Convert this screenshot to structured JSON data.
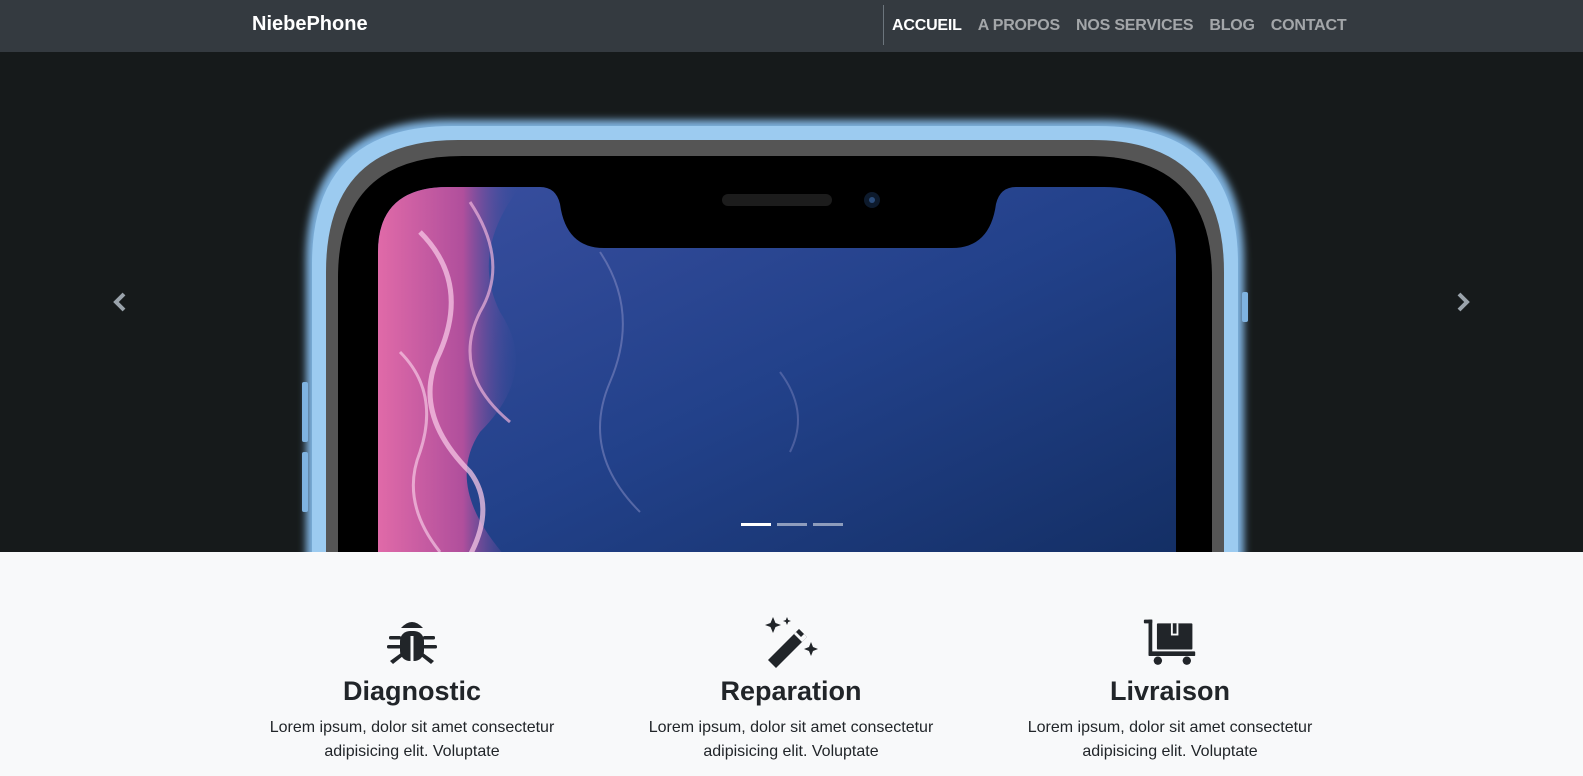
{
  "navbar": {
    "brand": "NiebePhone",
    "items": [
      {
        "label": "ACCUEIL",
        "active": true
      },
      {
        "label": "A PROPOS",
        "active": false
      },
      {
        "label": "NOS SERVICES",
        "active": false
      },
      {
        "label": "BLOG",
        "active": false
      },
      {
        "label": "CONTACT",
        "active": false
      }
    ]
  },
  "carousel": {
    "prev_icon": "chevron-left-icon",
    "next_icon": "chevron-right-icon",
    "slide_count": 3,
    "active_index": 0
  },
  "features": [
    {
      "icon": "bug-icon",
      "title": "Diagnostic",
      "text": "Lorem ipsum, dolor sit amet consectetur adipisicing elit. Voluptate"
    },
    {
      "icon": "magic-wand-icon",
      "title": "Reparation",
      "text": "Lorem ipsum, dolor sit amet consectetur adipisicing elit. Voluptate"
    },
    {
      "icon": "dolly-icon",
      "title": "Livraison",
      "text": "Lorem ipsum, dolor sit amet consectetur adipisicing elit. Voluptate"
    }
  ],
  "colors": {
    "navbar_bg": "#343a40",
    "hero_bg": "#161a1b",
    "phone_frame": "#8fc1ea",
    "features_bg": "#f8f9fa",
    "text": "#212529"
  }
}
